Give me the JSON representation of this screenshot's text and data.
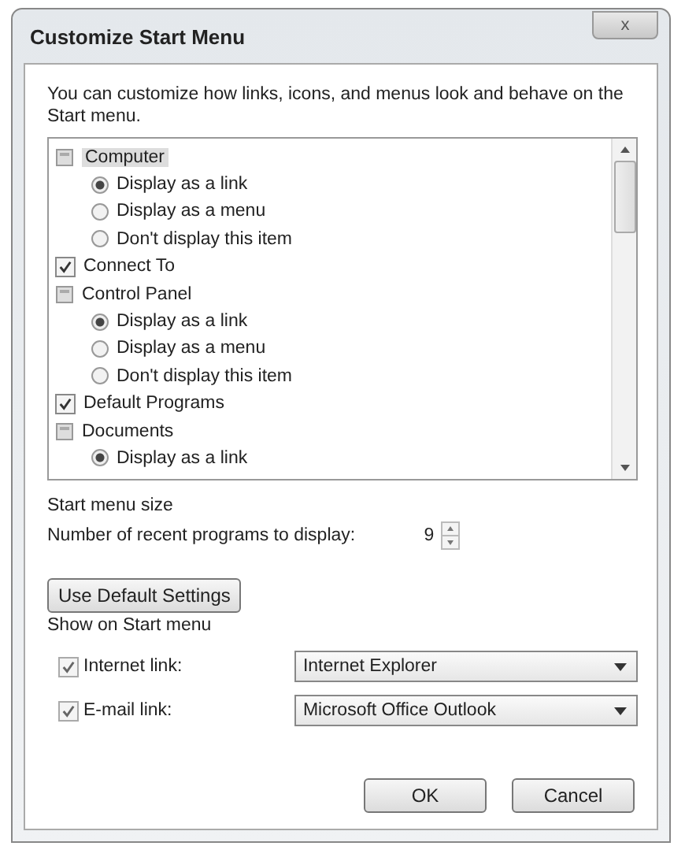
{
  "window": {
    "title": "Customize Start Menu",
    "close_label": "x"
  },
  "description": "You can customize how links, icons, and menus look and behave on the Start menu.",
  "items": [
    {
      "kind": "group",
      "label": "Computer",
      "selected": true,
      "children": [
        {
          "label": "Display as a link",
          "selected": true
        },
        {
          "label": "Display as a menu",
          "selected": false
        },
        {
          "label": "Don't display this item",
          "selected": false
        }
      ]
    },
    {
      "kind": "checkbox",
      "label": "Connect To",
      "checked": true
    },
    {
      "kind": "group",
      "label": "Control Panel",
      "selected": false,
      "children": [
        {
          "label": "Display as a link",
          "selected": true
        },
        {
          "label": "Display as a menu",
          "selected": false
        },
        {
          "label": "Don't display this item",
          "selected": false
        }
      ]
    },
    {
      "kind": "checkbox",
      "label": "Default Programs",
      "checked": true
    },
    {
      "kind": "group",
      "label": "Documents",
      "selected": false,
      "children": [
        {
          "label": "Display as a link",
          "selected": true
        }
      ]
    }
  ],
  "start_menu_size": {
    "heading": "Start menu size",
    "label": "Number of recent programs to display:",
    "value": "9"
  },
  "default_button": "Use Default Settings",
  "show_on_start": {
    "heading": "Show on Start menu",
    "rows": [
      {
        "label": "Internet link:",
        "checked": true,
        "value": "Internet Explorer"
      },
      {
        "label": "E-mail link:",
        "checked": true,
        "value": "Microsoft Office Outlook"
      }
    ]
  },
  "buttons": [
    "OK",
    "Cancel"
  ]
}
